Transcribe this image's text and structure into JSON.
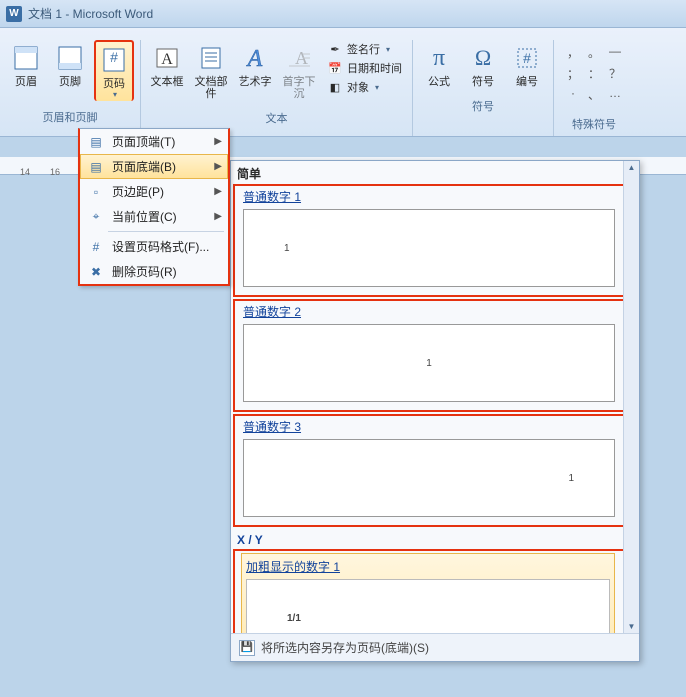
{
  "window": {
    "title": "文档 1 - Microsoft Word"
  },
  "ribbon": {
    "groups": {
      "headerfooter": {
        "label": "页眉和页脚",
        "header": "页眉",
        "footer": "页脚",
        "pageno": "页码"
      },
      "text": {
        "label": "文本",
        "textbox": "文本框",
        "docparts": "文档部件",
        "wordart": "艺术字",
        "dropcap": "首字下沉",
        "signature": "签名行",
        "datetime": "日期和时间",
        "object": "对象"
      },
      "symbols": {
        "label": "符号",
        "formula": "公式",
        "symbol": "符号",
        "number": "编号"
      },
      "special": {
        "label": "特殊符号"
      }
    }
  },
  "ruler": {
    "t14": "14",
    "t16": "16"
  },
  "menu": {
    "top_of_page": "页面顶端(T)",
    "bottom_of_page": "页面底端(B)",
    "page_margins": "页边距(P)",
    "current_pos": "当前位置(C)",
    "format": "设置页码格式(F)...",
    "remove": "删除页码(R)"
  },
  "gallery": {
    "cat_simple": "简单",
    "plain1": "普通数字 1",
    "plain2": "普通数字 2",
    "plain3": "普通数字 3",
    "cat_xy": "X / Y",
    "bold1": "加粗显示的数字 1",
    "sample_1": "1",
    "sample_xy": "1/1",
    "footer_label": "将所选内容另存为页码(底端)(S)"
  }
}
